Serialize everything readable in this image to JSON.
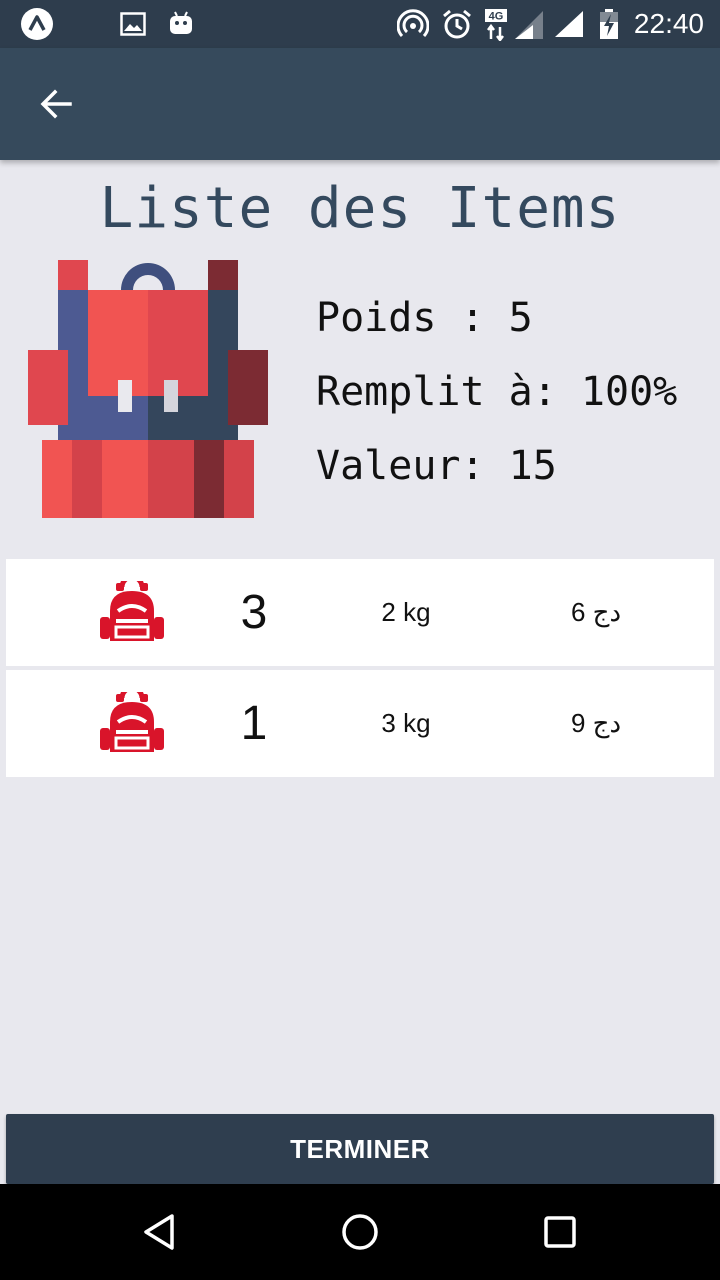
{
  "status_bar": {
    "time": "22:40",
    "network_type": "4G",
    "icons": [
      "app-logo-icon",
      "image-icon",
      "android-icon",
      "hotspot-icon",
      "alarm-icon",
      "signal-icon",
      "signal-icon",
      "battery-charging-icon"
    ]
  },
  "app_bar": {
    "back_icon": "arrow-left-icon"
  },
  "page": {
    "title": "Liste des Items"
  },
  "summary": {
    "illustration_icon": "backpack-icon",
    "weight_line": "Poids : 5",
    "fill_line": "Remplit à: 100%",
    "value_line": "Valeur: 15"
  },
  "items": [
    {
      "icon": "backpack-icon",
      "quantity": "3",
      "weight": "2 kg",
      "value": "6 دج"
    },
    {
      "icon": "backpack-icon",
      "quantity": "1",
      "weight": "3 kg",
      "value": "9 دج"
    }
  ],
  "finish_button": {
    "label": "TERMINER",
    "color": "#2f3e4f"
  },
  "navigation": {
    "icons": [
      "back-triangle-icon",
      "home-circle-icon",
      "recents-square-icon"
    ]
  },
  "colors": {
    "app_bar": "#364a5c",
    "status_bar": "#2e3d4d",
    "background": "#e8e8ee",
    "item_icon_red": "#d9142a",
    "title_text": "#34495e"
  }
}
